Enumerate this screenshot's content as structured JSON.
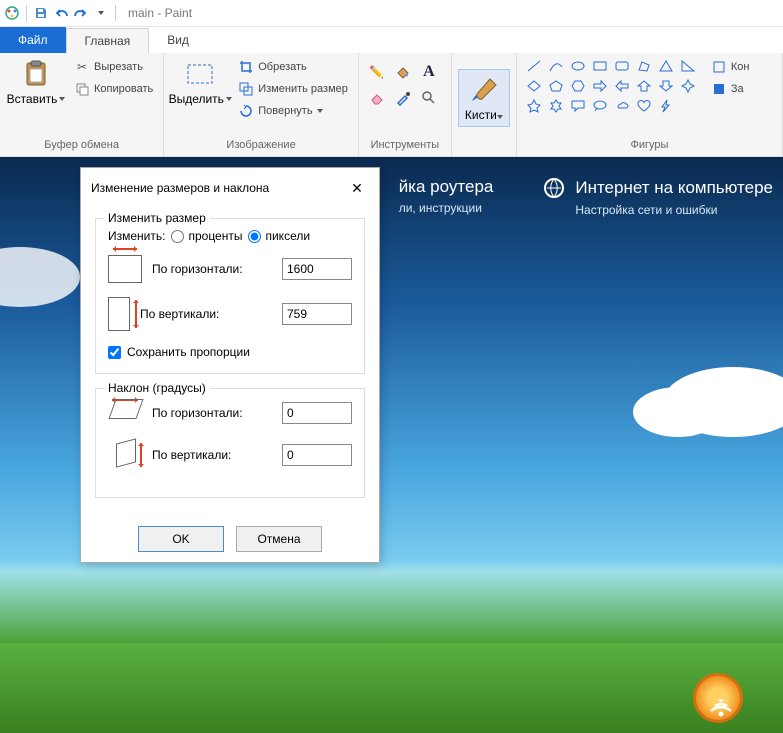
{
  "title": "main - Paint",
  "tabs": {
    "file": "Файл",
    "home": "Главная",
    "view": "Вид"
  },
  "groups": {
    "clipboard": {
      "label": "Буфер обмена",
      "paste": "Вставить",
      "cut": "Вырезать",
      "copy": "Копировать"
    },
    "image": {
      "label": "Изображение",
      "select": "Выделить",
      "crop": "Обрезать",
      "resize": "Изменить размер",
      "rotate": "Повернуть"
    },
    "tools": {
      "label": "Инструменты"
    },
    "brush": {
      "label": "Кисти"
    },
    "shapes": {
      "label": "Фигуры",
      "outline": "Кон",
      "fill": "За"
    }
  },
  "canvas": {
    "hd1": "йка роутера",
    "sub1": "ли, инструкции",
    "hd2": "Интернет на компьютере",
    "sub2": "Настройка сети и ошибки"
  },
  "dialog": {
    "title": "Изменение размеров и наклона",
    "resize_legend": "Изменить размер",
    "change": "Изменить:",
    "percent": "проценты",
    "pixels": "пиксели",
    "horiz": "По горизонтали:",
    "vert": "По вертикали:",
    "width_val": "1600",
    "height_val": "759",
    "lock": "Сохранить пропорции",
    "skew_legend": "Наклон (градусы)",
    "skew_h_val": "0",
    "skew_v_val": "0",
    "ok": "OK",
    "cancel": "Отмена"
  }
}
